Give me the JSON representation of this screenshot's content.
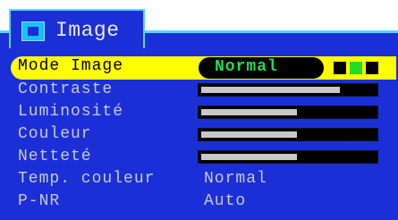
{
  "tab": {
    "title": "Image",
    "icon": "monitor-icon"
  },
  "menu": {
    "selected": {
      "label": "Mode Image",
      "value": "Normal",
      "indicator_colors": [
        "#000000",
        "#22dd22",
        "#000000"
      ]
    },
    "items": [
      {
        "label": "Contraste",
        "level_percent": 80
      },
      {
        "label": "Luminosité",
        "level_percent": 55
      },
      {
        "label": "Couleur",
        "level_percent": 55
      },
      {
        "label": "Netteté",
        "level_percent": 55
      },
      {
        "label": "Temp. couleur",
        "value": "Normal"
      },
      {
        "label": "P-NR",
        "value": "Auto"
      }
    ]
  },
  "colors": {
    "panel": "#1b2fd6",
    "highlight": "#ffff00",
    "value_green": "#16e05a",
    "border": "#4fd8ff"
  }
}
